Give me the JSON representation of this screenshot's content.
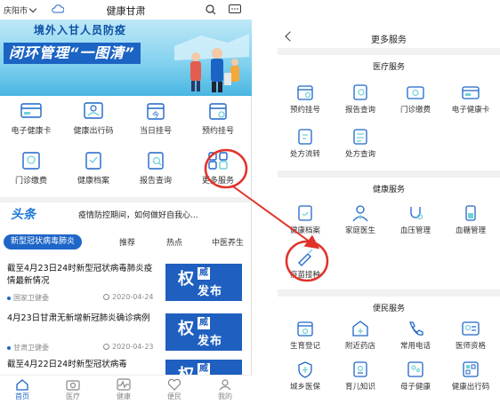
{
  "left": {
    "city": "庆阳市",
    "title": "健康甘肃",
    "banner": {
      "line1": "境外入甘人员防疫",
      "line2": "闭环管理“一图清”"
    },
    "services": [
      {
        "label": "电子健康卡",
        "icon": "health-card-icon"
      },
      {
        "label": "健康出行码",
        "icon": "travel-code-icon"
      },
      {
        "label": "当日挂号",
        "icon": "today-register-icon"
      },
      {
        "label": "预约挂号",
        "icon": "appointment-icon"
      },
      {
        "label": "门诊缴费",
        "icon": "payment-icon"
      },
      {
        "label": "健康档案",
        "icon": "health-record-icon"
      },
      {
        "label": "报告查询",
        "icon": "report-icon"
      },
      {
        "label": "更多服务",
        "icon": "more-services-icon"
      }
    ],
    "news_logo": "头条",
    "news_text": "疫情防控期间，如何做好自我心...",
    "tabs": [
      "新型冠状病毒肺炎",
      "推荐",
      "热点",
      "中医养生"
    ],
    "articles": [
      {
        "title": "截至4月23日24时新型冠状病毒肺炎疫情最新情况",
        "source": "国家卫健委",
        "date": "2020-04-24"
      },
      {
        "title": "4月23日甘肃无新增新冠肺炎确诊病例",
        "source": "甘肃卫健委",
        "date": "2020-04-23"
      },
      {
        "title": "截至4月22日24时新型冠状病毒",
        "source": "",
        "date": ""
      }
    ],
    "thumb": {
      "big": "权",
      "wei": "威",
      "fabu": "发布"
    },
    "bottom_nav": [
      "首页",
      "医疗",
      "健康",
      "便民",
      "我的"
    ]
  },
  "right": {
    "title": "更多服务",
    "sections": [
      {
        "title": "医疗服务",
        "items": [
          {
            "label": "预约挂号",
            "icon": "calendar-icon"
          },
          {
            "label": "报告查询",
            "icon": "report-search-icon"
          },
          {
            "label": "门诊缴费",
            "icon": "payment-icon"
          },
          {
            "label": "电子健康卡",
            "icon": "health-card-icon"
          },
          {
            "label": "处方流转",
            "icon": "prescription-flow-icon"
          },
          {
            "label": "处方查询",
            "icon": "prescription-search-icon"
          }
        ]
      },
      {
        "title": "健康服务",
        "items": [
          {
            "label": "健康档案",
            "icon": "health-record-icon"
          },
          {
            "label": "家庭医生",
            "icon": "doctor-icon"
          },
          {
            "label": "血压管理",
            "icon": "blood-pressure-icon"
          },
          {
            "label": "血糖管理",
            "icon": "blood-sugar-icon"
          },
          {
            "label": "疫苗接种",
            "icon": "vaccine-icon"
          }
        ]
      },
      {
        "title": "便民服务",
        "items": [
          {
            "label": "生育登记",
            "icon": "birth-register-icon"
          },
          {
            "label": "附近药店",
            "icon": "pharmacy-icon"
          },
          {
            "label": "常用电话",
            "icon": "phone-icon"
          },
          {
            "label": "医师资格",
            "icon": "doctor-license-icon"
          },
          {
            "label": "城乡医保",
            "icon": "insurance-icon"
          },
          {
            "label": "育儿知识",
            "icon": "parenting-icon"
          },
          {
            "label": "母子健康",
            "icon": "mother-child-icon"
          },
          {
            "label": "健康出行码",
            "icon": "travel-code-icon"
          }
        ]
      }
    ]
  },
  "colors": {
    "accent": "#1e66c8",
    "annotation": "#e0332b"
  }
}
